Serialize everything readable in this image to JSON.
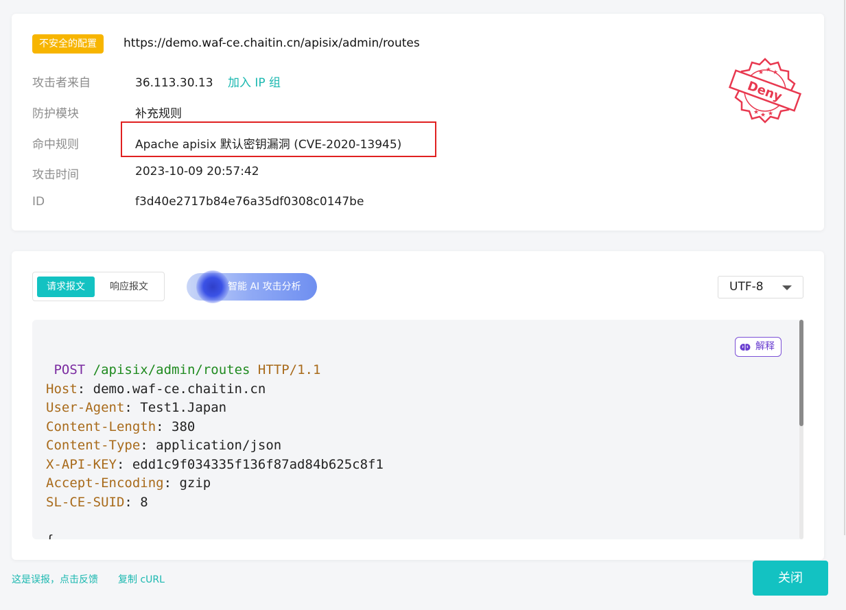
{
  "detail": {
    "badge": "不安全的配置",
    "url": "https://demo.waf-ce.chaitin.cn/apisix/admin/routes",
    "rows": [
      {
        "label": "攻击者来自",
        "value": "36.113.30.13",
        "action": "加入 IP 组"
      },
      {
        "label": "防护模块",
        "value": "补充规则"
      },
      {
        "label": "命中规则",
        "value": "Apache apisix 默认密钥漏洞 (CVE-2020-13945)"
      },
      {
        "label": "攻击时间",
        "value": "2023-10-09 20:57:42"
      },
      {
        "label": "ID",
        "value": "f3d40e2717b84e76a35df0308c0147be"
      }
    ],
    "stamp_text": "Deny",
    "stamp_color": "#e8384f"
  },
  "request": {
    "tabs": [
      "请求报文",
      "响应报文"
    ],
    "active_tab": 0,
    "ai_button": "智能 AI 攻击分析",
    "encoding": "UTF-8",
    "explain_button": "解释",
    "method": "POST",
    "path": "/apisix/admin/routes",
    "version": "HTTP/1.1",
    "headers": [
      {
        "key": "Host",
        "value": "demo.waf-ce.chaitin.cn"
      },
      {
        "key": "User-Agent",
        "value": "Test1.Japan"
      },
      {
        "key": "Content-Length",
        "value": "380"
      },
      {
        "key": "Content-Type",
        "value": "application/json"
      },
      {
        "key": "X-API-KEY",
        "value": "edd1c9f034335f136f87ad84b625c8f1"
      },
      {
        "key": "Accept-Encoding",
        "value": "gzip"
      },
      {
        "key": "SL-CE-SUID",
        "value": "8"
      }
    ],
    "body_start": "{"
  },
  "footer": {
    "feedback_link": "这是误报，点击反馈",
    "copy_curl": "复制 cURL",
    "close_button": "关闭"
  },
  "colors": {
    "accent": "#13c2c2",
    "warning": "#f7b500",
    "highlight_border": "#e02020"
  }
}
